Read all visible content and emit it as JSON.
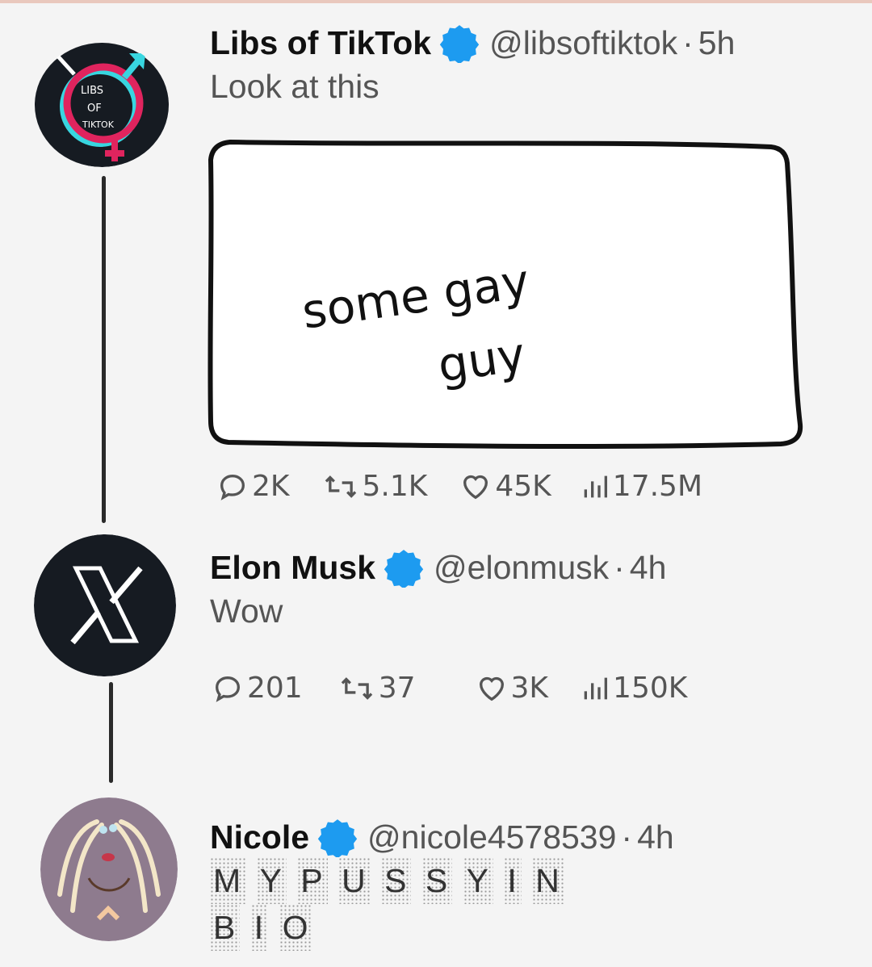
{
  "thread": [
    {
      "name": "Libs of TikTok",
      "handle": "@libsoftiktok",
      "separator": "·",
      "time": "5h",
      "text": "Look at this",
      "media_text": [
        "some gay",
        "guy"
      ],
      "stats": {
        "replies": "2K",
        "retweets": "5.1K",
        "likes": "45K",
        "views": "17.5M"
      },
      "avatar_icon": "libs-of-tiktok-logo",
      "avatar_text": [
        "LIBS",
        "OF",
        "TIKTOK"
      ]
    },
    {
      "name": "Elon Musk",
      "handle": "@elonmusk",
      "separator": "·",
      "time": "4h",
      "text": "Wow",
      "stats": {
        "replies": "201",
        "retweets": "37",
        "likes": "3K",
        "views": "150K"
      },
      "avatar_icon": "x-logo"
    },
    {
      "name": "Nicole",
      "handle": "@nicole4578539",
      "separator": "·",
      "time": "4h",
      "text_lines": [
        [
          "M",
          "Y",
          "P",
          "U",
          "S",
          "S",
          "Y",
          "I",
          "N"
        ],
        [
          "B",
          "I",
          "O"
        ]
      ],
      "avatar_icon": "drawn-face-avatar"
    }
  ],
  "colors": {
    "verified_badge": "#1d9bf0",
    "avatar_dark": "#161b22",
    "nicole_avatar_bg": "#8e7b8e",
    "libs_ring_pink": "#e0245e",
    "libs_ring_cyan": "#38d6e0"
  }
}
